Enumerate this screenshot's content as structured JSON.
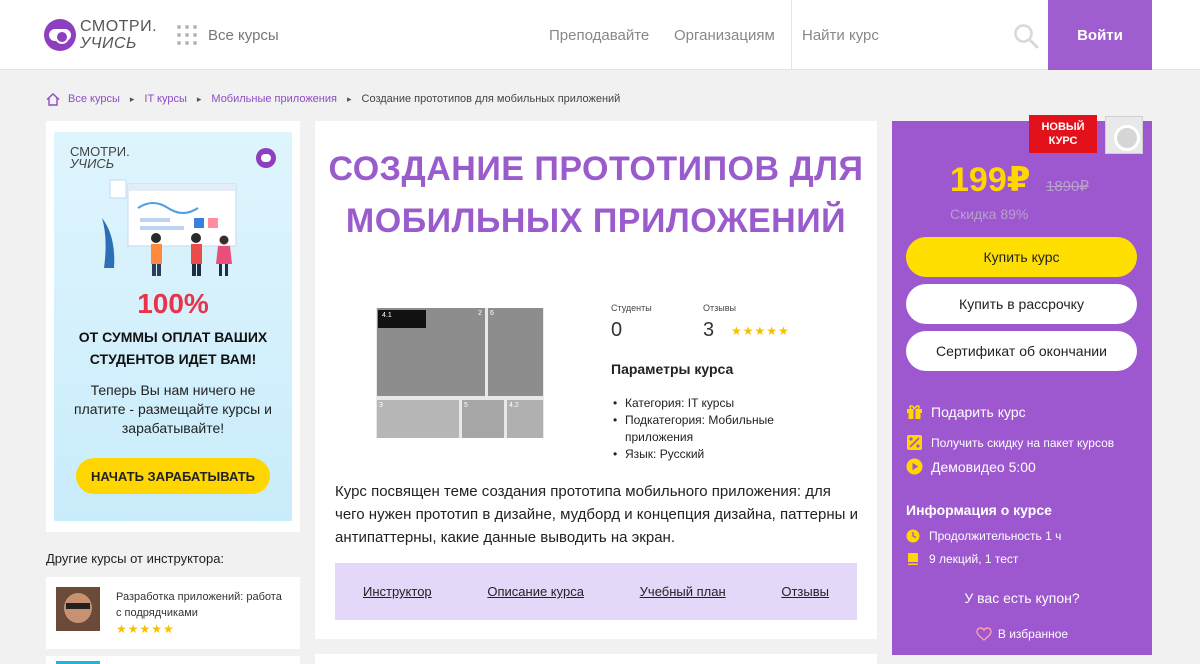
{
  "header": {
    "logo_line1": "СМОТРИ.",
    "logo_line2": "УЧИСЬ",
    "all_courses": "Все курсы",
    "nav_teach": "Преподавайте",
    "nav_orgs": "Организациям",
    "search_placeholder": "Найти курс",
    "login": "Войти"
  },
  "breadcrumb": [
    "Все курсы",
    "IT курсы",
    "Мобильные приложения",
    "Создание прототипов для мобильных приложений"
  ],
  "ad": {
    "logo_line1": "СМОТРИ.",
    "logo_line2": "УЧИСЬ",
    "percent": "100%",
    "headline": "ОТ СУММЫ ОПЛАТ ВАШИХ СТУДЕНТОВ ИДЕТ ВАМ!",
    "sub": "Теперь Вы нам ничего не платите - размещайте курсы и зарабатывайте!",
    "button": "НАЧАТЬ ЗАРАБАТЫВАТЬ"
  },
  "other_courses": {
    "title": "Другие курсы от инструктора:",
    "items": [
      {
        "title": "Разработка приложений: работа с подрядчиками",
        "stars": "★★★★★"
      }
    ]
  },
  "course": {
    "title": "СОЗДАНИЕ ПРОТОТИПОВ ДЛЯ МОБИЛЬНЫХ ПРИЛОЖЕНИЙ",
    "students_label": "Студенты",
    "students_value": "0",
    "reviews_label": "Отзывы",
    "reviews_value": "3",
    "rating_stars": "★★★★★",
    "params_title": "Параметры курса",
    "params": [
      "Категория: IT курсы",
      "Подкатегория: Мобильные приложения",
      "Язык: Русский"
    ],
    "description": "Курс посвящен теме создания прототипа мобильного приложения: для чего нужен прототип в дизайне, мудборд и концепция дизайна, паттерны и антипаттерны, какие данные выводить на экран.",
    "tabs": [
      "Инструктор",
      "Описание курса",
      "Учебный план",
      "Отзывы"
    ],
    "preview_labels": [
      "4.1",
      "2",
      "6",
      "3",
      "5",
      "4.2"
    ]
  },
  "purchase": {
    "badge": "НОВЫЙ КУРС",
    "price": "199₽",
    "old_price": "1890₽",
    "discount": "Скидка 89%",
    "buy": "Купить курс",
    "installment": "Купить в рассрочку",
    "certificate": "Сертификат об окончании",
    "gift": "Подарить курс",
    "bundle": "Получить скидку на пакет курсов",
    "demo": "Демовидео 5:00",
    "info_title": "Информация о курсе",
    "duration": "Продолжительность 1 ч",
    "lectures": "9 лекций, 1 тест",
    "coupon": "У вас есть купон?",
    "favorite": "В избранное"
  },
  "colors": {
    "brand_purple": "#9d57cf",
    "title_purple": "#9a5bcc",
    "yellow": "#ffdf00",
    "badge_red": "#e3111b",
    "tabs_bg": "#e3d8f8"
  }
}
